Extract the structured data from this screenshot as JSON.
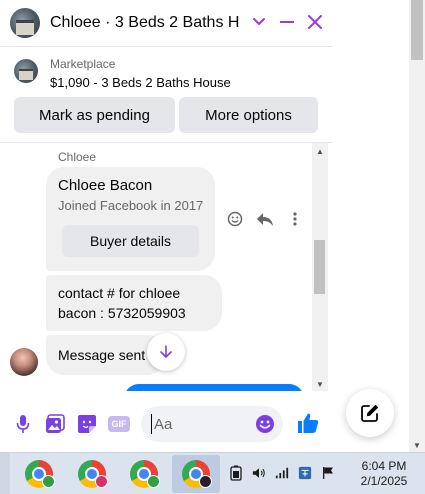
{
  "chat": {
    "title": "Chloee · 3 Beds 2 Baths H...",
    "marketplace": {
      "label": "Marketplace",
      "listing": "$1,090 - 3 Beds 2 Baths House",
      "pending_button": "Mark as pending",
      "options_button": "More options"
    },
    "messages": {
      "sender_name": "Chloee",
      "profile_card": {
        "name": "Chloee Bacon",
        "subtitle": "Joined Facebook in 2017",
        "button": "Buyer details"
      },
      "contact_text": "contact # for chloee bacon : 5732059903",
      "sent_text": "Message sent"
    },
    "composer": {
      "placeholder": "Aa",
      "gif_label": "GIF"
    }
  },
  "taskbar": {
    "apps": [
      {
        "name": "Google Chrome",
        "profile_color": "#2f9e44"
      },
      {
        "name": "Google Chrome",
        "profile_color": "#d6336c"
      },
      {
        "name": "Google Chrome",
        "profile_color": "#2f9e44"
      },
      {
        "name": "Google Chrome",
        "profile_color": "#2a1e2e",
        "active": true
      }
    ],
    "clock": {
      "time": "6:04 PM",
      "date": "2/1/2025"
    }
  },
  "colors": {
    "accent": "#7b3fe4",
    "header_icons": "#9b3bd8",
    "sent_bubble": "#0a7cff",
    "like": "#0a7cff"
  }
}
